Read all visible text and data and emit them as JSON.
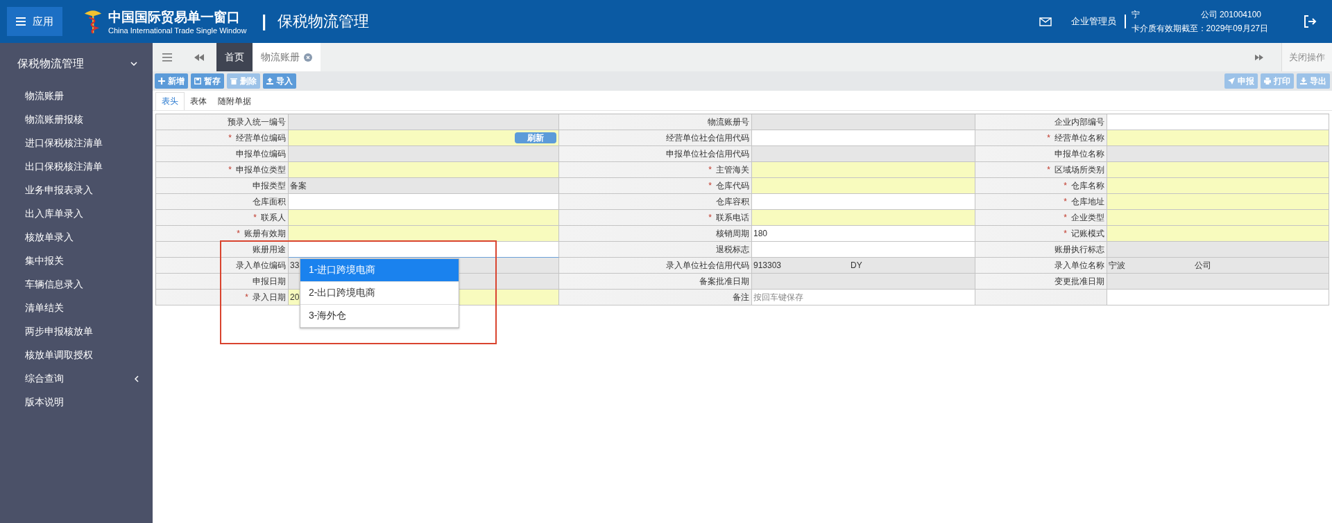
{
  "header": {
    "app_button": "应用",
    "brand_cn": "中国国际贸易单一窗口",
    "brand_en": "China International Trade Single Window",
    "separator": "|",
    "module": "保税物流管理",
    "role": "企业管理员",
    "user_org_parts": [
      "宁",
      "公司 201004100"
    ],
    "card_expiry": "卡介质有效期截至：2029年09月27日"
  },
  "sidebar": {
    "title": "保税物流管理",
    "items": [
      {
        "label": "物流账册",
        "kind": "link"
      },
      {
        "label": "物流账册报核",
        "kind": "link"
      },
      {
        "label": "进口保税核注清单",
        "kind": "link"
      },
      {
        "label": "出口保税核注清单",
        "kind": "link"
      },
      {
        "label": "业务申报表录入",
        "kind": "link"
      },
      {
        "label": "出入库单录入",
        "kind": "link"
      },
      {
        "label": "核放单录入",
        "kind": "link"
      },
      {
        "label": "集中报关",
        "kind": "link"
      },
      {
        "label": "车辆信息录入",
        "kind": "link"
      },
      {
        "label": "清单结关",
        "kind": "link"
      },
      {
        "label": "两步申报核放单",
        "kind": "link"
      },
      {
        "label": "核放单调取授权",
        "kind": "link"
      },
      {
        "label": "综合查询",
        "kind": "group",
        "expanded": false
      },
      {
        "label": "版本说明",
        "kind": "link"
      }
    ]
  },
  "tabs": [
    {
      "label": "首页",
      "selected": false,
      "closable": false
    },
    {
      "label": "物流账册",
      "selected": true,
      "closable": true
    }
  ],
  "close_ops": "关闭操作",
  "toolbar_left": [
    {
      "label": "新增",
      "disabled": false
    },
    {
      "label": "暂存",
      "disabled": false
    },
    {
      "label": "删除",
      "disabled": true
    },
    {
      "label": "导入",
      "disabled": false
    }
  ],
  "toolbar_right": [
    {
      "label": "申报",
      "disabled": true
    },
    {
      "label": "打印",
      "disabled": true
    },
    {
      "label": "导出",
      "disabled": true
    }
  ],
  "subtabs": [
    {
      "label": "表头",
      "selected": true
    },
    {
      "label": "表体",
      "selected": false
    },
    {
      "label": "随附单据",
      "selected": false
    }
  ],
  "form": {
    "rows": [
      [
        {
          "label": "预录入统一编号",
          "kind": "readonly"
        },
        {
          "label": "物流账册号",
          "kind": "readonly"
        },
        {
          "label": "企业内部编号",
          "kind": "input"
        }
      ],
      [
        {
          "label": "经营单位编码",
          "mark": "*",
          "kind": "required",
          "button": "刷新"
        },
        {
          "label": "经营单位社会信用代码",
          "kind": "input"
        },
        {
          "label": "经营单位名称",
          "mark": "*",
          "kind": "required"
        }
      ],
      [
        {
          "label": "申报单位编码",
          "kind": "readonly"
        },
        {
          "label": "申报单位社会信用代码",
          "kind": "readonly"
        },
        {
          "label": "申报单位名称",
          "kind": "readonly"
        }
      ],
      [
        {
          "label": "申报单位类型",
          "mark": "*",
          "kind": "required"
        },
        {
          "label": "主管海关",
          "mark": "*",
          "kind": "required"
        },
        {
          "label": "区域场所类别",
          "mark": "*",
          "kind": "required"
        }
      ],
      [
        {
          "label": "申报类型",
          "kind": "readonly",
          "value": [
            "备案"
          ]
        },
        {
          "label": "仓库代码",
          "mark": "*",
          "kind": "required"
        },
        {
          "label": "仓库名称",
          "mark": "*",
          "kind": "required"
        }
      ],
      [
        {
          "label": "仓库面积",
          "kind": "input"
        },
        {
          "label": "仓库容积",
          "kind": "input"
        },
        {
          "label": "仓库地址",
          "mark": "*",
          "kind": "required"
        }
      ],
      [
        {
          "label": "联系人",
          "mark": "*",
          "kind": "required"
        },
        {
          "label": "联系电话",
          "mark": "*",
          "kind": "required"
        },
        {
          "label": "企业类型",
          "mark": "*",
          "kind": "required"
        }
      ],
      [
        {
          "label": "账册有效期",
          "mark": "*",
          "kind": "required"
        },
        {
          "label": "核销周期",
          "kind": "input",
          "value": [
            "180"
          ]
        },
        {
          "label": "记账模式",
          "mark": "*",
          "kind": "required"
        }
      ],
      [
        {
          "label": "账册用途",
          "kind": "select"
        },
        {
          "label": "退税标志",
          "kind": "input"
        },
        {
          "label": "账册执行标志",
          "kind": "readonly"
        }
      ],
      [
        {
          "label": "录入单位编码",
          "kind": "readonly",
          "value": [
            "33"
          ]
        },
        {
          "label": "录入单位社会信用代码",
          "kind": "readonly",
          "value": [
            "913303",
            "DY"
          ]
        },
        {
          "label": "录入单位名称",
          "kind": "readonly",
          "value": [
            "宁波",
            "公司"
          ]
        }
      ],
      [
        {
          "label": "申报日期",
          "kind": "readonly"
        },
        {
          "label": "备案批准日期",
          "kind": "readonly"
        },
        {
          "label": "变更批准日期",
          "kind": "readonly"
        }
      ],
      [
        {
          "label": "录入日期",
          "mark": "*",
          "kind": "required",
          "value": [
            "20"
          ]
        },
        {
          "label": "备注",
          "kind": "input",
          "placeholder": "按回车键保存"
        },
        {
          "kind": "empty"
        }
      ]
    ]
  },
  "dropdown": {
    "options": [
      {
        "label": "1-进口跨境电商",
        "selected": true
      },
      {
        "label": "2-出口跨境电商",
        "selected": false
      },
      {
        "label": "3-海外仓",
        "selected": false
      }
    ]
  },
  "annotation_box": true
}
